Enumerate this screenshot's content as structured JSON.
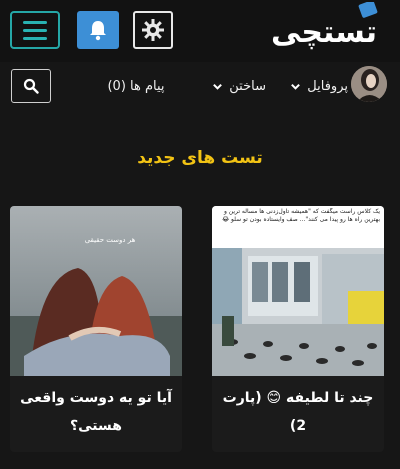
{
  "header": {
    "logo_text": "تستچی",
    "icons": [
      "menu-icon",
      "bell-icon",
      "gear-icon"
    ]
  },
  "nav": {
    "search_icon": "search-icon",
    "messages_label": "پیام ها (0)",
    "build_label": "ساختن",
    "profile_label": "پروفایل"
  },
  "section": {
    "title": "تست های جدید"
  },
  "cards": [
    {
      "title": "آیا تو یه دوست واقعی هستی؟",
      "image_text": "ﻫﺮ ﺩﻭﺳﺖ ﺣﻘﯿﻘﯽ"
    },
    {
      "title": "چند تا لطیفه 😊 (پارت 2)",
      "image_text": "یک کلاس راست میگفت که \"همیشه تاول‌زدنی ها مساله ترین و بهترین راه ها رو پیدا می کنند\"... صف وایستاده بودن تو سلو 😂"
    }
  ],
  "colors": {
    "accent_teal": "#25a7a7",
    "bell_blue": "#3d8fd6",
    "title_yellow": "#f2c314",
    "background": "#161616"
  }
}
